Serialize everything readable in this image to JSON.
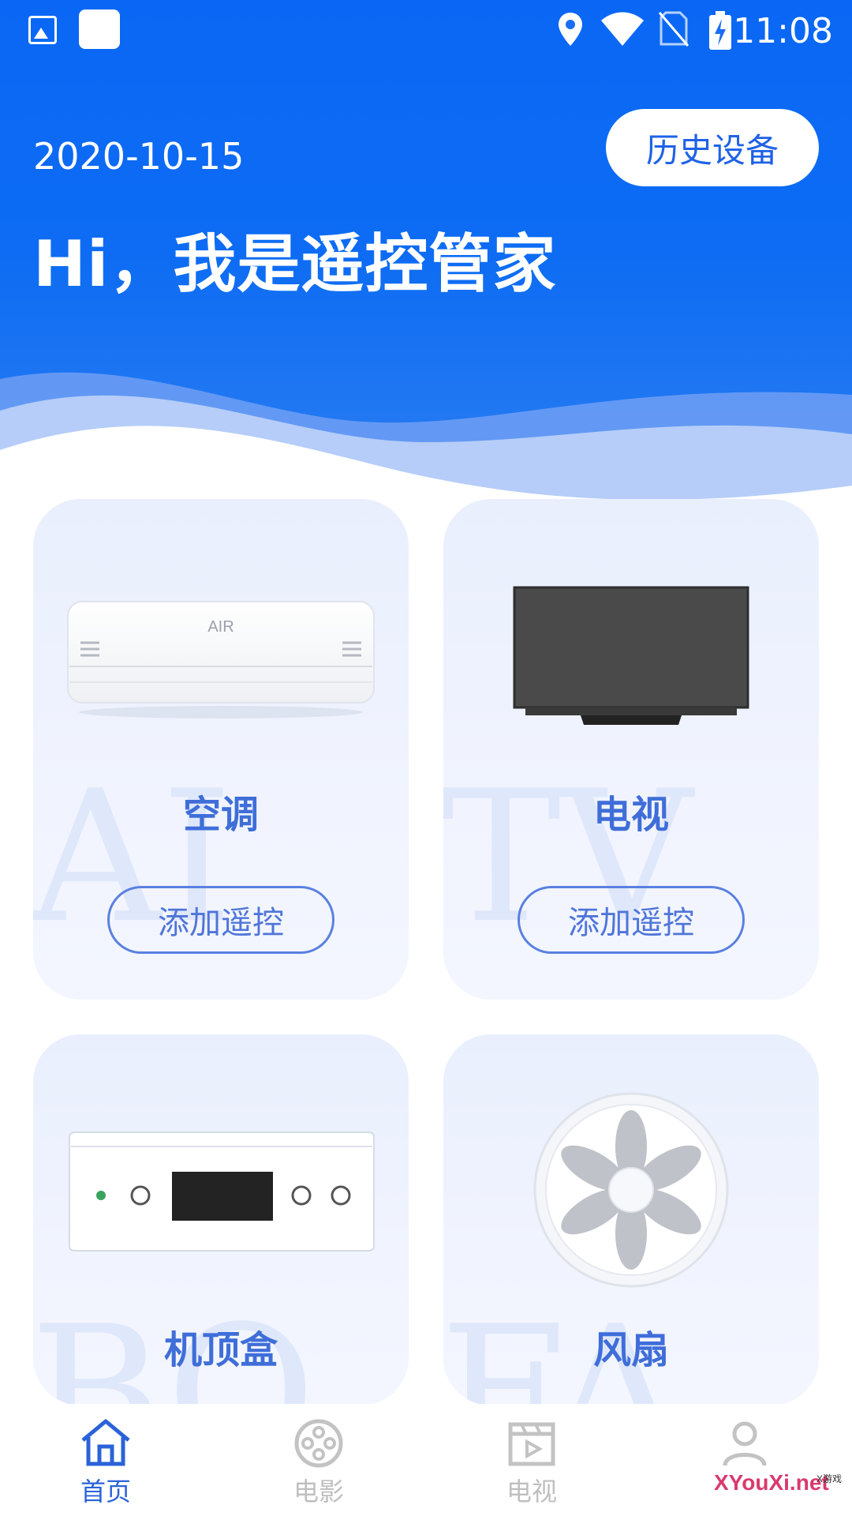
{
  "status_bar": {
    "time": "11:08",
    "icons": [
      "image-icon",
      "square-icon",
      "location-icon",
      "wifi-icon",
      "no-sim-icon",
      "battery-charging-icon"
    ]
  },
  "header": {
    "date": "2020-10-15",
    "history_button": "历史设备",
    "greeting": "Hi，我是遥控管家"
  },
  "devices": [
    {
      "name": "空调",
      "button": "添加遥控",
      "bg_letters": "AI",
      "icon": "air-conditioner-icon",
      "image_label": "AIR"
    },
    {
      "name": "电视",
      "button": "添加遥控",
      "bg_letters": "TV",
      "icon": "tv-icon"
    },
    {
      "name": "机顶盒",
      "button": "",
      "bg_letters": "BO",
      "icon": "set-top-box-icon"
    },
    {
      "name": "风扇",
      "button": "",
      "bg_letters": "FA",
      "icon": "fan-icon"
    }
  ],
  "tabs": [
    {
      "label": "首页",
      "icon": "home-icon",
      "active": true
    },
    {
      "label": "电影",
      "icon": "film-reel-icon",
      "active": false
    },
    {
      "label": "电视",
      "icon": "clapper-video-icon",
      "active": false
    },
    {
      "label": "",
      "icon": "user-icon",
      "active": false
    }
  ],
  "watermark": {
    "text": "XYouXi.net",
    "small": "X游戏"
  },
  "colors": {
    "primary": "#0a67f5",
    "accent": "#3f6ed9",
    "card_bg": "#eef2fd",
    "tab_inactive": "#bfbfbf"
  }
}
